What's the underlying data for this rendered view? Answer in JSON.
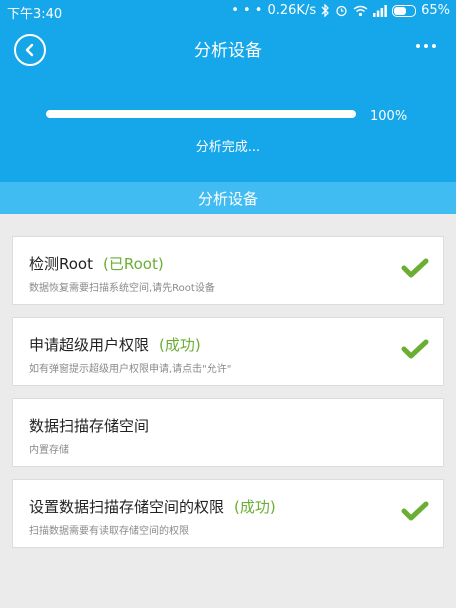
{
  "status_bar": {
    "time": "下午3:40",
    "speed": "0.26K/s",
    "battery": "65%"
  },
  "header": {
    "title": "分析设备",
    "progress_percent": 100,
    "progress_label": "100%",
    "progress_status": "分析完成..."
  },
  "section": {
    "title": "分析设备"
  },
  "items": [
    {
      "title": "检测Root",
      "status": "(已Root)",
      "desc": "数据恢复需要扫描系统空间,请先Root设备",
      "checked": true
    },
    {
      "title": "申请超级用户权限",
      "status": "(成功)",
      "desc": "如有弹窗提示超级用户权限申请,请点击\"允许\"",
      "checked": true
    },
    {
      "title": "数据扫描存储空间",
      "status": "",
      "desc": "内置存储",
      "checked": false
    },
    {
      "title": "设置数据扫描存储空间的权限",
      "status": "(成功)",
      "desc": "扫描数据需要有读取存储空间的权限",
      "checked": true
    }
  ],
  "colors": {
    "primary": "#15a7ea",
    "section_bar": "#40bcf2",
    "success": "#6aae34"
  },
  "icons": [
    "back-arrow-icon",
    "more-dots-icon",
    "check-icon",
    "bluetooth-icon",
    "alarm-icon",
    "wifi-icon",
    "signal-icon",
    "battery-icon"
  ]
}
